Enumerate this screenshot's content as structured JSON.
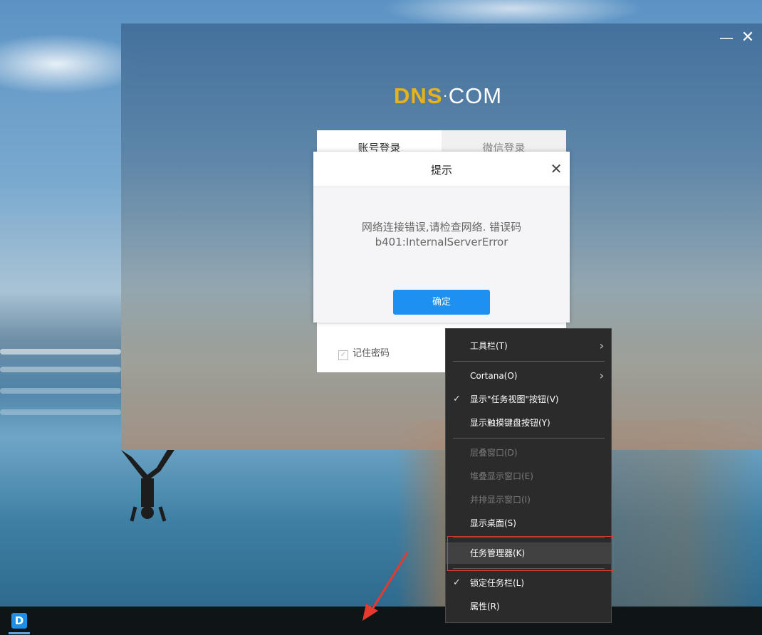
{
  "app": {
    "logo": {
      "part1": "DNS",
      "part2": "·",
      "part3": "COM"
    },
    "window_controls": {
      "minimize": "—",
      "close": "✕"
    },
    "login": {
      "tabs": [
        "账号登录",
        "微信登录"
      ],
      "remember_label": "记住密码"
    }
  },
  "dialog": {
    "title": "提示",
    "close": "✕",
    "message_line1": "网络连接错误,请检查网络. 错误码",
    "message_line2": "b401:InternalServerError",
    "ok_label": "确定",
    "ok_color": "#1e90f0"
  },
  "context_menu": {
    "items": [
      {
        "label": "工具栏(T)",
        "submenu": true
      },
      {
        "label": "Cortana(O)",
        "submenu": true
      },
      {
        "label": "显示\"任务视图\"按钮(V)",
        "checked": true
      },
      {
        "label": "显示触摸键盘按钮(Y)"
      },
      {
        "label": "层叠窗口(D)",
        "disabled": true
      },
      {
        "label": "堆叠显示窗口(E)",
        "disabled": true
      },
      {
        "label": "并排显示窗口(I)",
        "disabled": true
      },
      {
        "label": "显示桌面(S)"
      },
      {
        "label": "任务管理器(K)",
        "hovered": true
      },
      {
        "label": "锁定任务栏(L)",
        "checked": true
      },
      {
        "label": "属性(R)"
      }
    ],
    "check_glyph": "✓",
    "arrow_glyph": "›"
  },
  "taskbar": {
    "app_icon_letter": "D",
    "app_icon_color": "#1e8fe6"
  },
  "annotation": {
    "highlight_color": "#e23a3a"
  }
}
